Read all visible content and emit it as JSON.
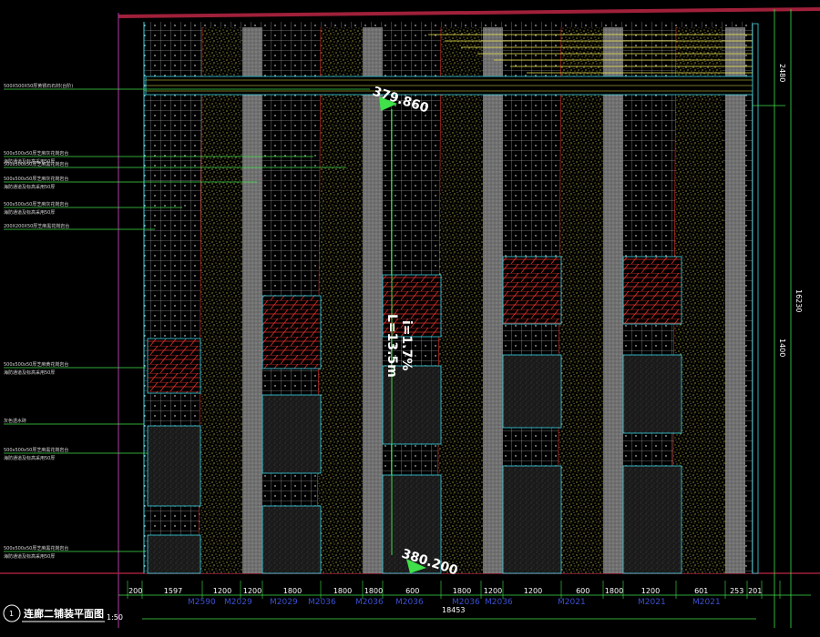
{
  "drawing": {
    "title_number": "1",
    "title": "连廊二铺装平面图",
    "scale": "1:50"
  },
  "leader_labels": [
    {
      "line1": "500X500X50厚黄锈石石材(台阶)",
      "line2": ""
    },
    {
      "line1": "500x500x50厚芝麻灰花岗岩台",
      "line2": "海防通道及标高采用50厚"
    },
    {
      "line1": "500x500x50厚芝麻黑花岗岩台",
      "line2": ""
    },
    {
      "line1": "500x500x50厚芝麻灰花岗岩台",
      "line2": "海防通道及标高采用50厚"
    },
    {
      "line1": "500x500x50厚芝麻灰花岗岩台",
      "line2": "海防通道及标高采用50厚"
    },
    {
      "line1": "200X200X50厚芝麻黑花岗岩台",
      "line2": ""
    },
    {
      "line1": "500x500x50厚芝麻黄花岗岩台",
      "line2": "海防通道及标高采用50厚"
    },
    {
      "line1": "灰色透水砖",
      "line2": ""
    },
    {
      "line1": "500x500x50厚芝麻黑花岗岩台",
      "line2": "海防通道及标高采用50厚"
    },
    {
      "line1": "500x500x50厚芝麻黑花岗岩台",
      "line2": "海防通道及标高采用50厚"
    }
  ],
  "elevations": {
    "top": "379.860",
    "bottom": "380.200"
  },
  "slope": {
    "length": "L=13.5m",
    "grade": "i=1.7%"
  },
  "dims_bottom": [
    "200",
    "1597",
    "1200",
    "1200",
    "1800",
    "1800",
    "1800",
    "600",
    "1800",
    "1200",
    "1200",
    "600",
    "1800",
    "1200",
    "601",
    "253",
    "201"
  ],
  "dim_total": "18453",
  "dims_right": [
    "2480",
    "16230",
    "1400"
  ],
  "drawing_codes": [
    "M2590",
    "M2029",
    "M2029",
    "M2036",
    "M2036",
    "M2036",
    "M2036",
    "M2036",
    "M2021",
    "M2021",
    "M2021"
  ],
  "colors": {
    "background": "#000000",
    "grid": "#ffffff",
    "sand_dots": "#f2e94a",
    "gravel": "#7a7a7a",
    "red_hatch": "#e0302a",
    "cyan": "#36d6e6",
    "green": "#3fe04a",
    "magenta": "#b03aa8",
    "dark_red": "#a0203a"
  }
}
